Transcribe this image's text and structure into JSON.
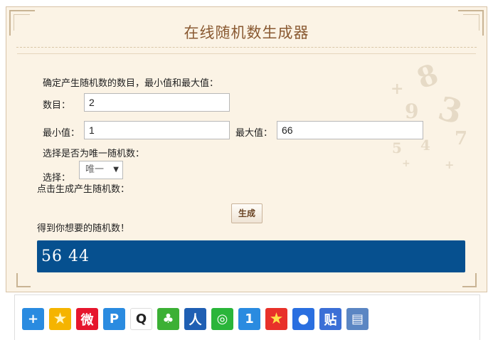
{
  "title": "在线随机数生成器",
  "form": {
    "intro_label": "确定产生随机数的数目，最小值和最大值：",
    "count_label": "数目：",
    "count_value": "2",
    "min_label": "最小值：",
    "min_value": "1",
    "max_label": "最大值：",
    "max_value": "66",
    "unique_prompt": "选择是否为唯一随机数：",
    "select_label": "选择：",
    "select_value": "唯一",
    "generate_prompt": "点击生成产生随机数：",
    "generate_button": "生成",
    "result_label": "得到你想要的随机数！",
    "result_value": "56 44"
  },
  "share": {
    "icons": [
      {
        "name": "share-more-icon",
        "color": "#2a8be0",
        "glyph": "+"
      },
      {
        "name": "qzone-icon",
        "color": "#f5b400",
        "glyph": "★"
      },
      {
        "name": "weibo-icon",
        "color": "#e6162d",
        "glyph": "微"
      },
      {
        "name": "tencent-weibo-icon",
        "color": "#2a8be0",
        "glyph": "P"
      },
      {
        "name": "qq-icon",
        "color": "#ffffff",
        "glyph": "Q"
      },
      {
        "name": "kaixin-icon",
        "color": "#3cb035",
        "glyph": "♣"
      },
      {
        "name": "renren-icon",
        "color": "#1f5fb3",
        "glyph": "人"
      },
      {
        "name": "wechat-icon",
        "color": "#2ab53a",
        "glyph": "◎"
      },
      {
        "name": "yiyi-icon",
        "color": "#2a8be0",
        "glyph": "1"
      },
      {
        "name": "favorite-star-icon",
        "color": "#e8312a",
        "glyph": "★"
      },
      {
        "name": "baidu-icon",
        "color": "#2a6fe0",
        "glyph": "●"
      },
      {
        "name": "tieba-icon",
        "color": "#3b6fd6",
        "glyph": "贴"
      },
      {
        "name": "print-icon",
        "color": "#5b86c3",
        "glyph": "▤"
      }
    ]
  }
}
